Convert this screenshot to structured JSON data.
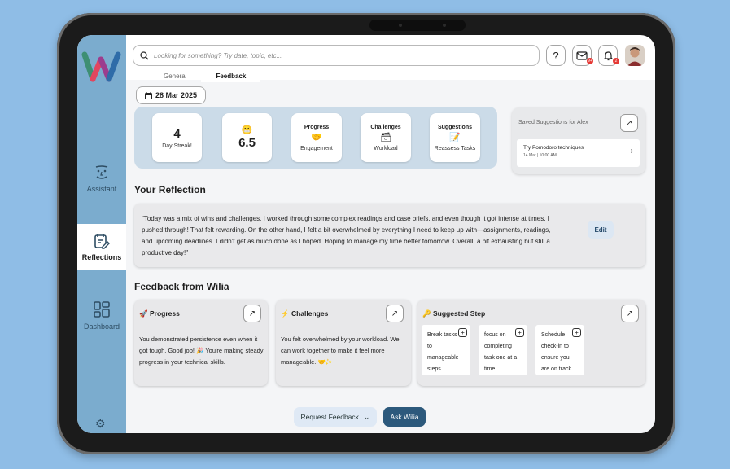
{
  "search": {
    "placeholder": "Looking for something? Try date, topic, etc..."
  },
  "header": {
    "help_label": "?",
    "mail_badge": "9+",
    "bell_badge": "2"
  },
  "sidebar": {
    "items": [
      {
        "label": "Assistant"
      },
      {
        "label": "Reflections"
      },
      {
        "label": "Dashboard"
      }
    ]
  },
  "tabs": [
    {
      "label": "General"
    },
    {
      "label": "Feedback"
    }
  ],
  "date": "28 Mar 2025",
  "stats": {
    "streak_value": "4",
    "streak_label": "Day Streak!",
    "mood_value": "6.5",
    "progress_title": "Progress",
    "progress_label": "Engagement",
    "challenges_title": "Challenges",
    "challenges_label": "Workload",
    "suggestions_title": "Suggestions",
    "suggestions_label": "Reassess Tasks"
  },
  "saved": {
    "title": "Saved Suggestions for Alex",
    "item_title": "Try Pomodoro techniques",
    "item_date": "14 Mar | 10:00 AM"
  },
  "reflection": {
    "heading": "Your Reflection",
    "text": "\"Today was a mix of wins and challenges. I worked through some complex readings and case briefs, and even though it got intense at times, I pushed through! That felt rewarding. On the other hand, I felt a bit overwhelmed by everything I need to keep up with—assignments, readings, and upcoming deadlines. I didn't get as much done as I hoped. Hoping to manage my time better tomorrow. Overall, a bit exhausting but still a productive day!\"",
    "edit_label": "Edit"
  },
  "feedback": {
    "heading": "Feedback from Wilia",
    "progress_title": "Progress",
    "progress_text": "You demonstrated persistence even when it got tough. Good job! 🎉 You're making steady progress in your technical skills.",
    "challenges_title": "Challenges",
    "challenges_text": "You felt overwhelmed by your workload. We can work together to make it feel more manageable. 🤝✨",
    "step_title": "Suggested Step",
    "steps": [
      {
        "text": "Break tasks to manageable steps."
      },
      {
        "text": "focus on completing task one at a time."
      },
      {
        "text": "Schedule check-in to ensure you are on track."
      }
    ]
  },
  "actions": {
    "request_label": "Request Feedback",
    "ask_label": "Ask Wilia"
  },
  "colors": {
    "sidebar": "#7bacce",
    "stats_panel": "#cbdbe8",
    "primary_button": "#2c597c"
  }
}
